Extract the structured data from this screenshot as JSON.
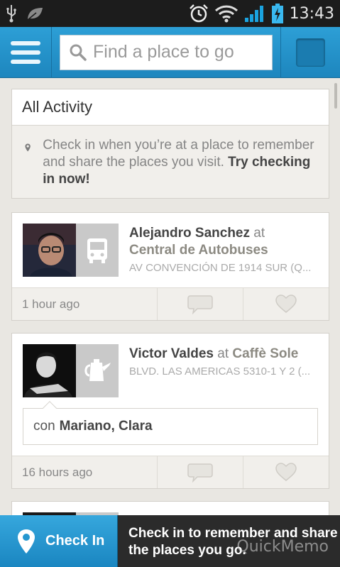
{
  "status_bar": {
    "time": "13:43",
    "icons": [
      "usb-icon",
      "leaf-icon",
      "alarm-icon",
      "wifi-icon",
      "signal-icon",
      "battery-charging-icon"
    ]
  },
  "top_bar": {
    "search": {
      "placeholder": "Find a place to go",
      "value": ""
    },
    "menu_icon": "hamburger-icon",
    "accent_color": "#2499d1"
  },
  "activity": {
    "title": "All Activity",
    "prompt": "Check in when you’re at a place to remember and share the places you visit.",
    "prompt_cta": "Try checking in now!"
  },
  "checkins": [
    {
      "user": "Alejandro Sanchez",
      "at": "at",
      "venue": "Central de Autobuses",
      "address": "AV CONVENCIÓN DE 1914 SUR (Q...",
      "venue_icon": "bus-icon",
      "time": "1 hour ago"
    },
    {
      "user": "Victor Valdes",
      "at": "at",
      "venue": "Caffè Sole",
      "address": "BLVD. LAS AMERICAS 5310-1 Y 2 (...",
      "venue_icon": "coffee-pot-icon",
      "with_prefix": "con",
      "with_names": "Mariano, Clara",
      "time": "16 hours ago"
    }
  ],
  "bottom_bar": {
    "checkin_label": "Check In",
    "message": "Check in to remember and share the places you go.",
    "watermark": "QuickMemo"
  }
}
